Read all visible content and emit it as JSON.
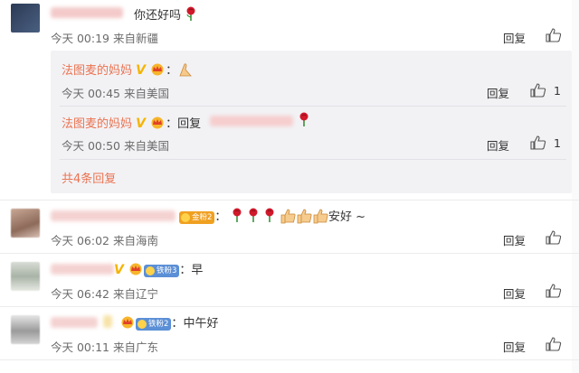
{
  "comments": [
    {
      "text": "你还好吗",
      "time": "今天 00:19 来自新疆",
      "reply": "回复"
    },
    {
      "badge": "金粉2",
      "text": "安好 ~",
      "time": "今天 06:02 来自海南",
      "reply": "回复"
    },
    {
      "badge": "铁粉3",
      "text": "早",
      "time": "今天 06:42 来自辽宁",
      "reply": "回复"
    },
    {
      "badge": "铁粉2",
      "text": "中午好",
      "time": "今天 00:11 来自广东",
      "reply": "回复"
    }
  ],
  "subreplies": [
    {
      "author": "法图麦的妈妈",
      "verified": "V",
      "colon": "：",
      "time": "今天 00:45 来自美国",
      "reply": "回复",
      "likes": "1"
    },
    {
      "author": "法图麦的妈妈",
      "verified": "V",
      "colon": "：",
      "prefix": "回复",
      "time": "今天 00:50 来自美国",
      "reply": "回复",
      "likes": "1"
    }
  ],
  "more_replies": "共4条回复",
  "colors": {
    "accent": "#eb7350",
    "verified": "#f5b400",
    "gold_badge": "#f0a020",
    "iron_badge": "#5b8fd6"
  }
}
